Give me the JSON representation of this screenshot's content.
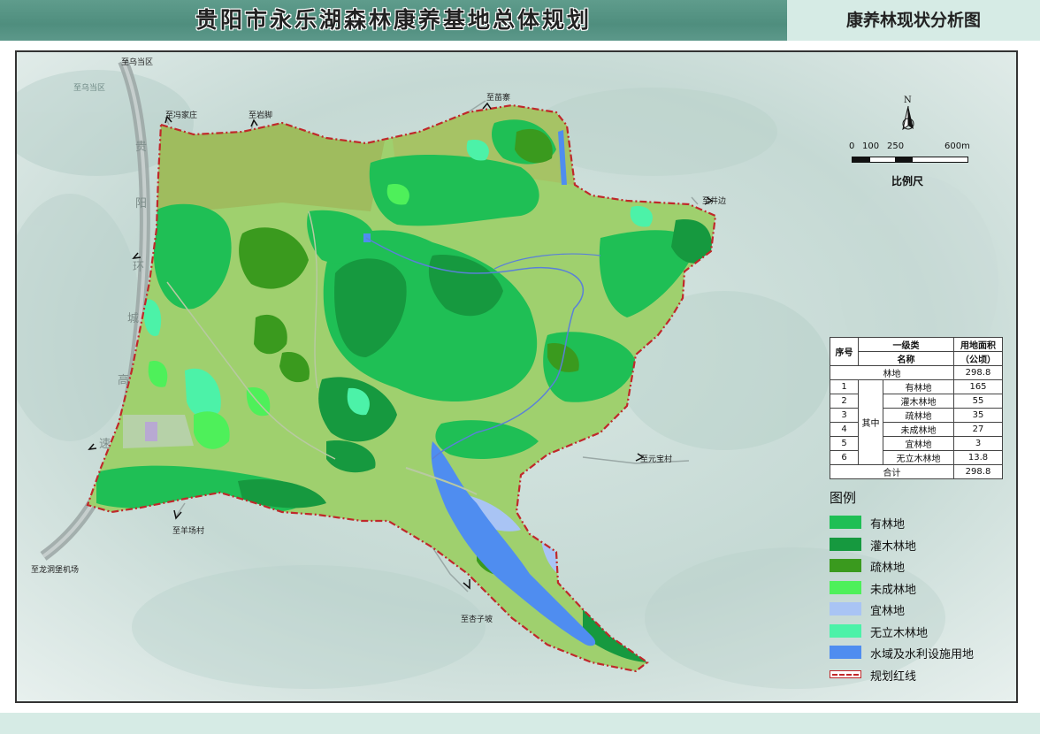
{
  "header": {
    "title": "贵阳市永乐湖森林康养基地总体规划",
    "subtitle": "康养林现状分析图"
  },
  "map": {
    "destinations": {
      "wudang": "至乌当区",
      "fengjiazhuang": "至冯家庄",
      "yanjiao": "至岩脚",
      "miaozhai": "至苗寨",
      "jingbian": "至井边",
      "yuanbaocun": "至元宝村",
      "yangchangcun": "至羊场村",
      "xingzipo": "至杏子坡",
      "longdongbao": "至龙洞堡机场"
    },
    "faded_label": "至乌当区",
    "highway_chars": [
      "贵",
      "阳",
      "环",
      "城",
      "高",
      "速"
    ]
  },
  "north_arrow": {
    "letter": "N"
  },
  "scale": {
    "ticks": [
      "0",
      "100",
      "250",
      "600m"
    ],
    "title": "比例尺"
  },
  "table": {
    "col_no": "序号",
    "col_class": "一级类",
    "col_name": "名称",
    "col_area": "用地面积",
    "col_unit": "（公顷）",
    "forest_label": "林地",
    "forest_total": "298.8",
    "group_label": "其中",
    "rows": [
      {
        "no": "1",
        "name": "有林地",
        "area": "165"
      },
      {
        "no": "2",
        "name": "灌木林地",
        "area": "55"
      },
      {
        "no": "3",
        "name": "疏林地",
        "area": "35"
      },
      {
        "no": "4",
        "name": "未成林地",
        "area": "27"
      },
      {
        "no": "5",
        "name": "宜林地",
        "area": "3"
      },
      {
        "no": "6",
        "name": "无立木林地",
        "area": "13.8"
      }
    ],
    "total_label": "合计",
    "total_value": "298.8"
  },
  "legend": {
    "title": "图例",
    "items": [
      {
        "label": "有林地",
        "color": "#1fbf55"
      },
      {
        "label": "灌木林地",
        "color": "#16993f"
      },
      {
        "label": "疏林地",
        "color": "#3a9a1e"
      },
      {
        "label": "未成林地",
        "color": "#4ef05a"
      },
      {
        "label": "宜林地",
        "color": "#a9c4f4"
      },
      {
        "label": "无立木林地",
        "color": "#4cf2a8"
      },
      {
        "label": "水域及水利设施用地",
        "color": "#4f8df0"
      },
      {
        "label": "规划红线",
        "color": "#c0282a"
      }
    ]
  },
  "colors": {
    "title_band": "#5a9888",
    "title_band_light": "#d6ebe5",
    "redline": "#c0282a",
    "base_land": "#9fd06e",
    "road": "#9aa8a6",
    "highway": "#9ba6a4"
  }
}
